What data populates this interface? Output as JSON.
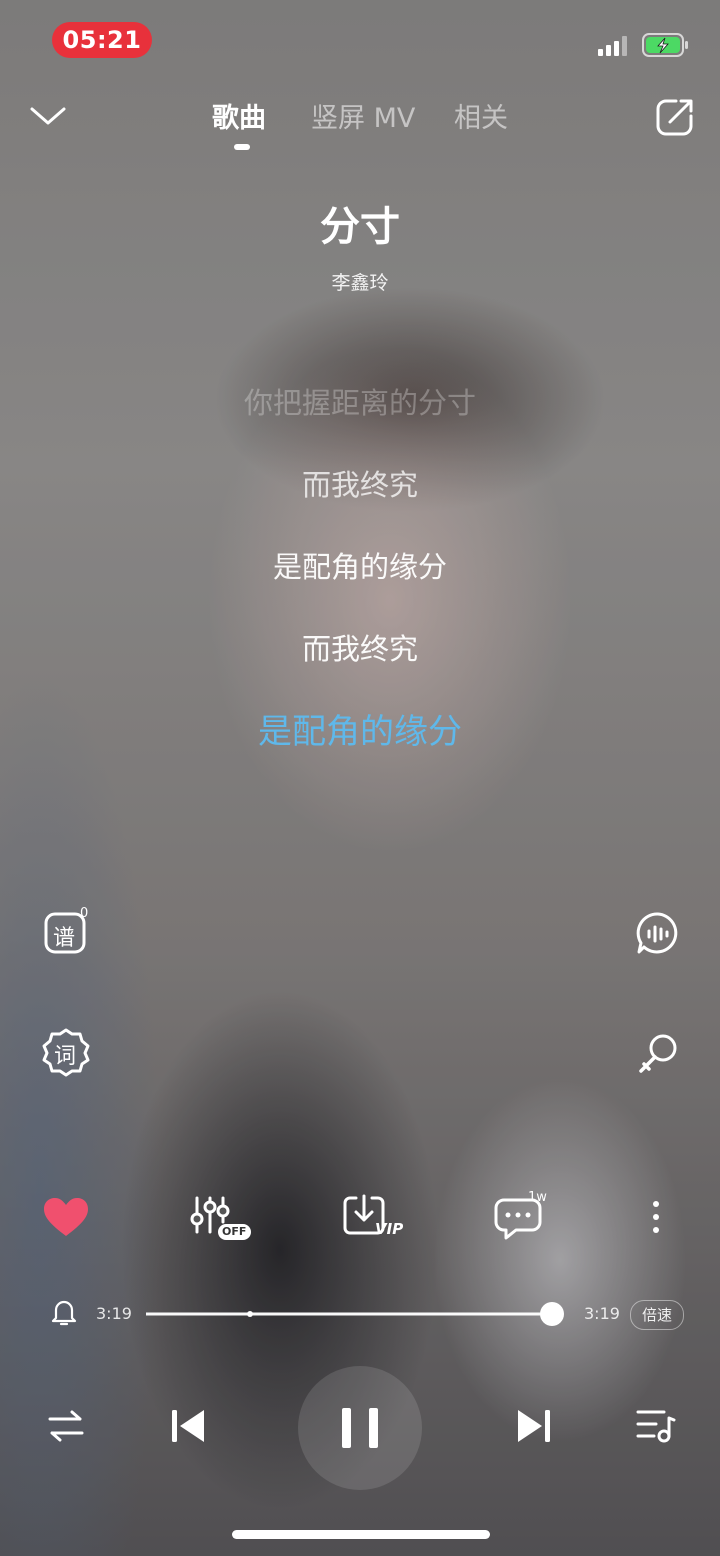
{
  "status_bar": {
    "time": "05:21"
  },
  "tabs": [
    {
      "label": "歌曲",
      "active": true
    },
    {
      "label": "竖屏 MV",
      "active": false
    },
    {
      "label": "相关",
      "active": false
    }
  ],
  "song": {
    "title": "分寸",
    "artist": "李鑫玲"
  },
  "lyrics": [
    "你把握距离的分寸",
    "而我终究",
    "是配角的缘分",
    "而我终究",
    "是配角的缘分"
  ],
  "side_buttons": {
    "score_label": "谱",
    "score_count": "0",
    "lyric_label": "词"
  },
  "actions": {
    "effect_badge": "OFF",
    "download_badge": "VIP",
    "comment_count": "1w"
  },
  "playback": {
    "current_time": "3:19",
    "total_time": "3:19",
    "progress": 1.0,
    "speed_label": "倍速"
  },
  "colors": {
    "accent_lyric": "#5fb8ea",
    "like_heart": "#f0506e",
    "status_time_bg": "#e8313b",
    "battery": "#4cd964"
  }
}
